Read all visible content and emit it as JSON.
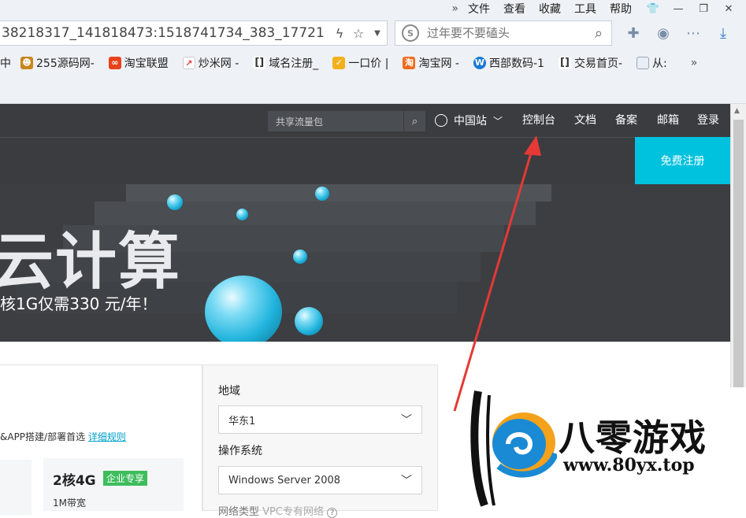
{
  "browser": {
    "menu": [
      "文件",
      "查看",
      "收藏",
      "工具",
      "帮助"
    ],
    "address": "38218317_141818473:1518741734_383_17721",
    "search_placeholder": "过年要不要磕头",
    "bookmarks": [
      "255源码网-",
      "淘宝联盟",
      "炒米网 -",
      "域名注册_",
      "一口价 |",
      "淘宝网 -",
      "西部数码-1",
      "交易首页-",
      "从:"
    ]
  },
  "site": {
    "shared_search": "共享流量包",
    "region": "中国站",
    "nav": [
      "控制台",
      "文档",
      "备案",
      "邮箱",
      "登录"
    ],
    "register": "免费注册",
    "banner_headline": "云计算",
    "banner_sub": "核1G仅需330 元/年！"
  },
  "content": {
    "promo_text": "&APP搭建/部署首选",
    "promo_link": "详细规则",
    "spec_title": "2核4G",
    "spec_badge": "企业专享",
    "spec_sub": "1M带宽",
    "region_label": "地域",
    "region_value": "华东1",
    "os_label": "操作系统",
    "os_value": "Windows Server 2008",
    "network_label": "网络类型",
    "network_value": "VPC专有网络"
  },
  "watermark": {
    "title": "八零游戏",
    "url": "www.80yx.top"
  },
  "colors": {
    "accent": "#00c1de",
    "nav_bg": "#3a3c40",
    "badge": "#3dbd5c",
    "arrow": "#e53935"
  }
}
